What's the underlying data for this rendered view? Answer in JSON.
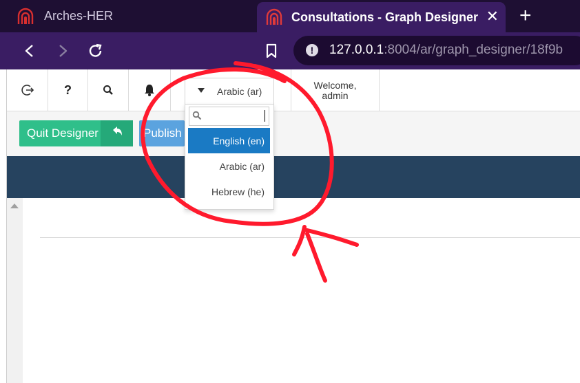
{
  "browser": {
    "tabs": [
      {
        "title": "Arches-HER",
        "active": false
      },
      {
        "title": "Consultations - Graph Designer",
        "active": true
      }
    ],
    "close_tab_glyph": "✕",
    "new_tab_glyph": "+",
    "url_host": "127.0.0.1",
    "url_rest": ":8004/ar/graph_designer/18f9b",
    "info_glyph": "!",
    "icons": [
      "back-icon",
      "forward-icon",
      "reload-icon",
      "bookmark-icon",
      "site-info-icon"
    ]
  },
  "toolbar": {
    "help_glyph": "?",
    "icons": [
      "sign-out-icon",
      "help-icon",
      "search-icon",
      "bell-icon"
    ],
    "welcome_line1": "Welcome,",
    "welcome_line2": "admin"
  },
  "language_selector": {
    "selected": "Arabic (ar)",
    "search_placeholder": "",
    "options": [
      {
        "label": "English (en)",
        "highlighted": true
      },
      {
        "label": "Arabic (ar)",
        "highlighted": false
      },
      {
        "label": "Hebrew (he)",
        "highlighted": false
      }
    ]
  },
  "designer": {
    "quit_label": "Quit Designer",
    "publish_label": "Publish"
  },
  "colors": {
    "tabstrip": "#1e0f33",
    "navbar": "#3a1d63",
    "quit_button": "#2fbf8a",
    "publish_button": "#5ba3df",
    "header_band": "#26435f",
    "dropdown_highlight": "#1a7ac4",
    "annotation": "#ff1a2d"
  }
}
